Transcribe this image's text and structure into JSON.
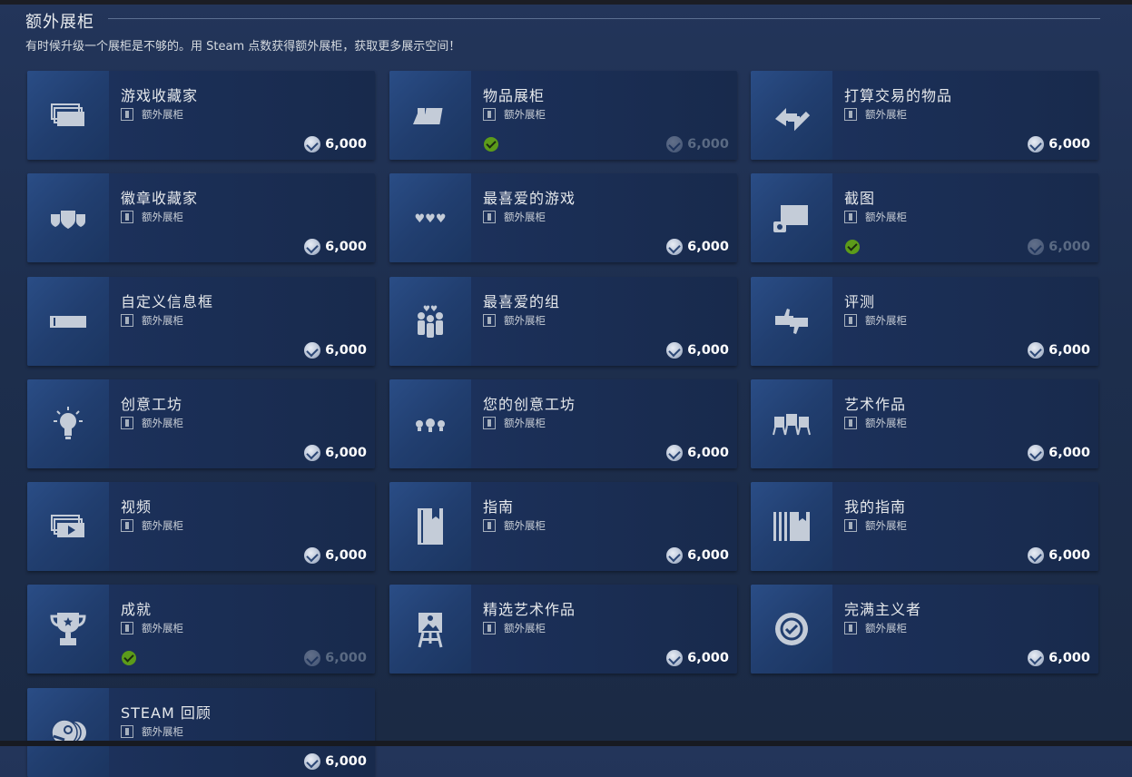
{
  "section": {
    "title": "额外展柜",
    "description": "有时候升级一个展柜是不够的。用 Steam 点数获得额外展柜，获取更多展示空间！"
  },
  "item_type_label": "额外展柜",
  "items": [
    {
      "name": "游戏收藏家",
      "price": "6,000",
      "owned": false,
      "icon": "game-collection-icon"
    },
    {
      "name": "物品展柜",
      "price": "6,000",
      "owned": true,
      "icon": "item-showcase-icon"
    },
    {
      "name": "打算交易的物品",
      "price": "6,000",
      "owned": false,
      "icon": "trade-items-icon"
    },
    {
      "name": "徽章收藏家",
      "price": "6,000",
      "owned": false,
      "icon": "badge-collector-icon"
    },
    {
      "name": "最喜爱的游戏",
      "price": "6,000",
      "owned": false,
      "icon": "favorite-game-icon"
    },
    {
      "name": "截图",
      "price": "6,000",
      "owned": true,
      "icon": "screenshot-icon"
    },
    {
      "name": "自定义信息框",
      "price": "6,000",
      "owned": false,
      "icon": "custom-info-box-icon"
    },
    {
      "name": "最喜爱的组",
      "price": "6,000",
      "owned": false,
      "icon": "favorite-group-icon"
    },
    {
      "name": "评测",
      "price": "6,000",
      "owned": false,
      "icon": "review-icon"
    },
    {
      "name": "创意工坊",
      "price": "6,000",
      "owned": false,
      "icon": "workshop-icon"
    },
    {
      "name": "您的创意工坊",
      "price": "6,000",
      "owned": false,
      "icon": "my-workshop-icon"
    },
    {
      "name": "艺术作品",
      "price": "6,000",
      "owned": false,
      "icon": "artwork-icon"
    },
    {
      "name": "视频",
      "price": "6,000",
      "owned": false,
      "icon": "video-icon"
    },
    {
      "name": "指南",
      "price": "6,000",
      "owned": false,
      "icon": "guide-icon"
    },
    {
      "name": "我的指南",
      "price": "6,000",
      "owned": false,
      "icon": "my-guides-icon"
    },
    {
      "name": "成就",
      "price": "6,000",
      "owned": true,
      "icon": "achievement-icon"
    },
    {
      "name": "精选艺术作品",
      "price": "6,000",
      "owned": false,
      "icon": "featured-artwork-icon"
    },
    {
      "name": "完满主义者",
      "price": "6,000",
      "owned": false,
      "icon": "completionist-icon"
    },
    {
      "name": "STEAM 回顾",
      "price": "6,000",
      "owned": false,
      "icon": "steam-replay-icon"
    }
  ]
}
